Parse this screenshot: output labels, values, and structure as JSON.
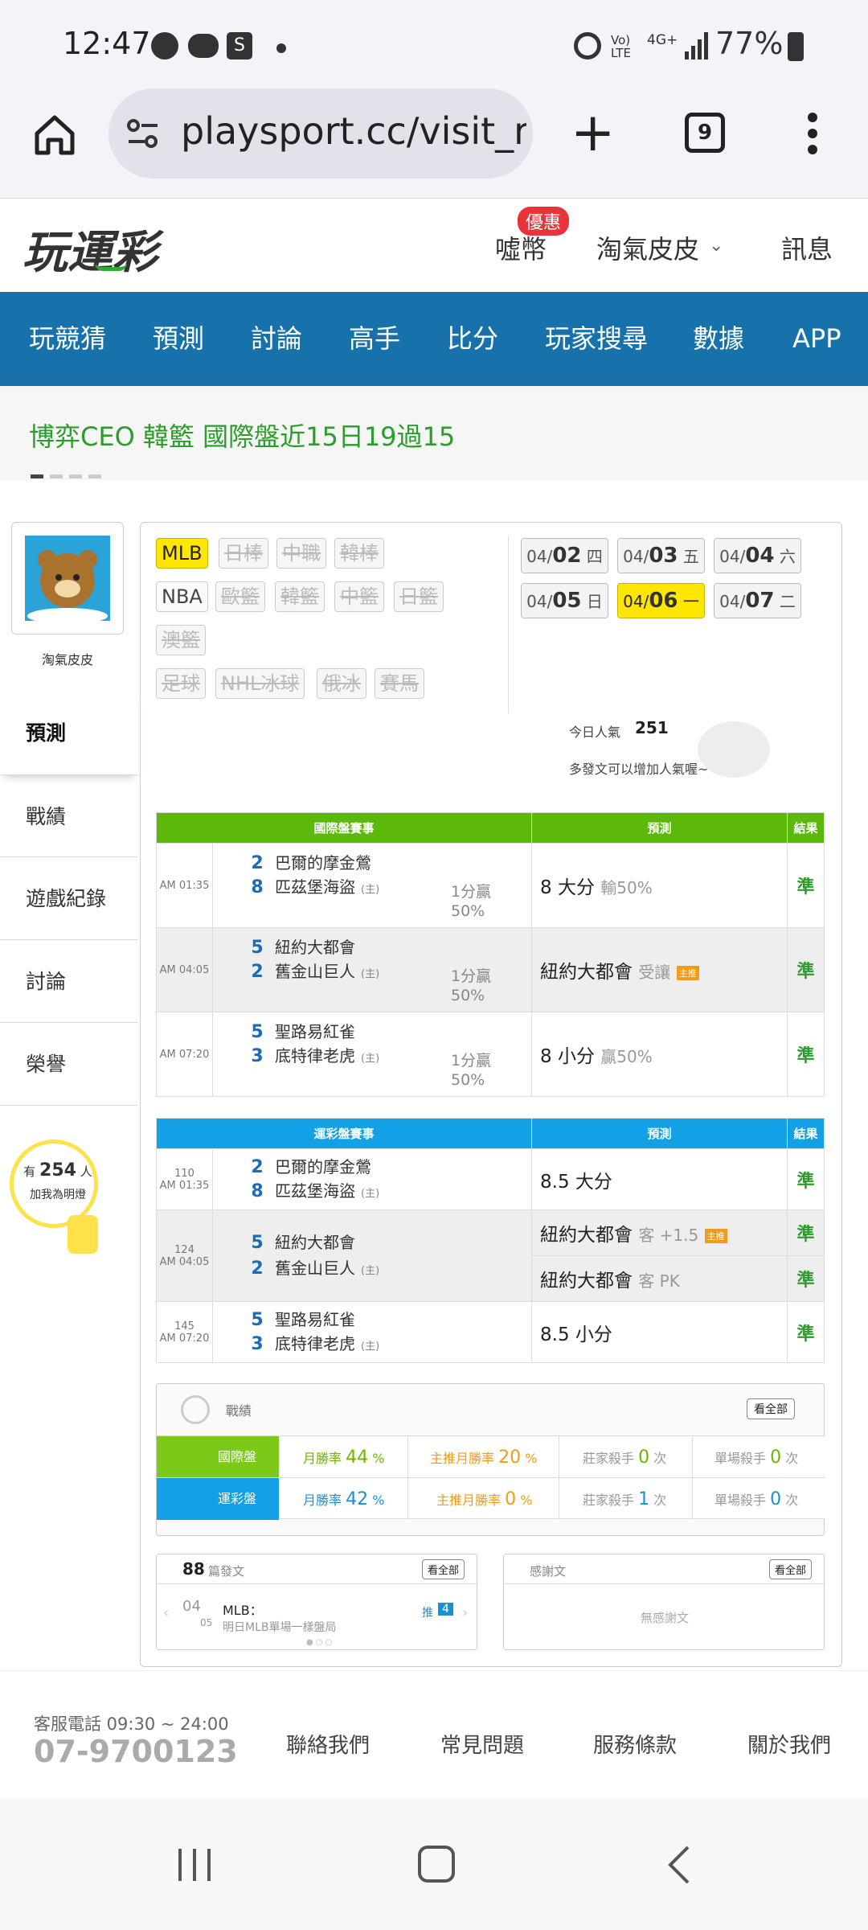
{
  "status": {
    "time": "12:47",
    "battery": "77%",
    "net": "4G+",
    "volte": "Vo) LTE"
  },
  "browser": {
    "url": "playsport.cc/visit_r",
    "tab_count": "9"
  },
  "header": {
    "logo": "玩運彩",
    "coins": "噓幣",
    "coins_badge": "優惠",
    "user": "淘氣皮皮",
    "messages": "訊息"
  },
  "nav": [
    "玩競猜",
    "預測",
    "討論",
    "高手",
    "比分",
    "玩家搜尋",
    "數據",
    "APP"
  ],
  "banner": {
    "text": "博弈CEO 韓籃 國際盤近15日19過15"
  },
  "profile": {
    "name": "淘氣皮皮"
  },
  "sidebar": [
    "預測",
    "戰績",
    "遊戲紀錄",
    "討論",
    "榮譽"
  ],
  "fans": {
    "prefix": "有",
    "count": "254",
    "suffix": "人",
    "line2": "加我為明燈"
  },
  "leagues": {
    "row1": [
      "MLB",
      "日棒",
      "中職",
      "韓棒"
    ],
    "row2": [
      "NBA",
      "歐籃",
      "韓籃",
      "中籃",
      "日籃"
    ],
    "row3": [
      "澳籃"
    ],
    "row4": [
      "足球",
      "NHL冰球",
      "俄冰",
      "賽馬"
    ]
  },
  "dates": [
    {
      "md": "04/",
      "d": "02",
      "w": "四"
    },
    {
      "md": "04/",
      "d": "03",
      "w": "五"
    },
    {
      "md": "04/",
      "d": "04",
      "w": "六"
    },
    {
      "md": "04/",
      "d": "05",
      "w": "日"
    },
    {
      "md": "04/",
      "d": "06",
      "w": "一"
    },
    {
      "md": "04/",
      "d": "07",
      "w": "二"
    }
  ],
  "popularity": {
    "label": "今日人氣",
    "value": "251",
    "hint": "多發文可以增加人氣喔~"
  },
  "intl": {
    "headers": [
      "國際盤賽事",
      "預測",
      "結果"
    ],
    "rows": [
      {
        "time": "AM 01:35",
        "s1": "2",
        "t1": "巴爾的摩金鶯",
        "s2": "8",
        "t2": "匹茲堡海盜",
        "home": "(主)",
        "line": "1分贏",
        "line2": "50%",
        "pred": "8 大分",
        "pred_note": "輸50%",
        "result": "準"
      },
      {
        "time": "AM 04:05",
        "s1": "5",
        "t1": "紐約大都會",
        "s2": "2",
        "t2": "舊金山巨人",
        "home": "(主)",
        "line": "1分贏",
        "line2": "50%",
        "pred": "紐約大都會",
        "pred_note": "受讓",
        "badge": "主推",
        "result": "準"
      },
      {
        "time": "AM 07:20",
        "s1": "5",
        "t1": "聖路易紅雀",
        "s2": "3",
        "t2": "底特律老虎",
        "home": "(主)",
        "line": "1分贏",
        "line2": "50%",
        "pred": "8 小分",
        "pred_note": "贏50%",
        "result": "準"
      }
    ]
  },
  "yun": {
    "headers": [
      "運彩盤賽事",
      "預測",
      "結果"
    ],
    "rows": [
      {
        "no": "110",
        "time": "AM 01:35",
        "s1": "2",
        "t1": "巴爾的摩金鶯",
        "s2": "8",
        "t2": "匹茲堡海盜",
        "home": "(主)",
        "preds": [
          {
            "p": "8.5 大分",
            "n": "",
            "r": "準"
          }
        ]
      },
      {
        "no": "124",
        "time": "AM 04:05",
        "s1": "5",
        "t1": "紐約大都會",
        "s2": "2",
        "t2": "舊金山巨人",
        "home": "(主)",
        "preds": [
          {
            "p": "紐約大都會",
            "n": "客 +1.5",
            "b": "主推",
            "r": "準"
          },
          {
            "p": "紐約大都會",
            "n": "客 PK",
            "r": "準"
          }
        ]
      },
      {
        "no": "145",
        "time": "AM 07:20",
        "s1": "5",
        "t1": "聖路易紅雀",
        "s2": "3",
        "t2": "底特律老虎",
        "home": "(主)",
        "preds": [
          {
            "p": "8.5 小分",
            "n": "",
            "r": "準"
          }
        ]
      }
    ]
  },
  "record": {
    "title": "戰績",
    "view_all": "看全部",
    "rows": [
      {
        "name": "國際盤",
        "mwr": "月勝率",
        "mwr_v": "44",
        "main": "主推月勝率",
        "main_v": "20",
        "bank": "莊家殺手",
        "bank_v": "0",
        "single": "單場殺手",
        "single_v": "0",
        "unit": "次",
        "pct": "%"
      },
      {
        "name": "運彩盤",
        "mwr": "月勝率",
        "mwr_v": "42",
        "main": "主推月勝率",
        "main_v": "0",
        "bank": "莊家殺手",
        "bank_v": "1",
        "single": "單場殺手",
        "single_v": "0",
        "unit": "次",
        "pct": "%"
      }
    ]
  },
  "posts": {
    "count": "88",
    "label": "篇發文",
    "view_all": "看全部",
    "date_m": "04",
    "date_d": "05",
    "title": "MLB：",
    "sub": "明日MLB單場一樣盤局",
    "push": "推",
    "push_n": "4"
  },
  "thanks": {
    "label": "感謝文",
    "view_all": "看全部",
    "empty": "無感謝文"
  },
  "footer": {
    "hours": "客服電話 09:30 ~ 24:00",
    "phone": "07-9700123",
    "links": [
      "聯絡我們",
      "常見問題",
      "服務條款",
      "關於我們"
    ]
  },
  "colors": {
    "nav": "#1772ab",
    "green": "#5cb80a",
    "blue": "#13a0e4",
    "yellow": "#ffe600",
    "banner_text": "#2a9d2a"
  }
}
